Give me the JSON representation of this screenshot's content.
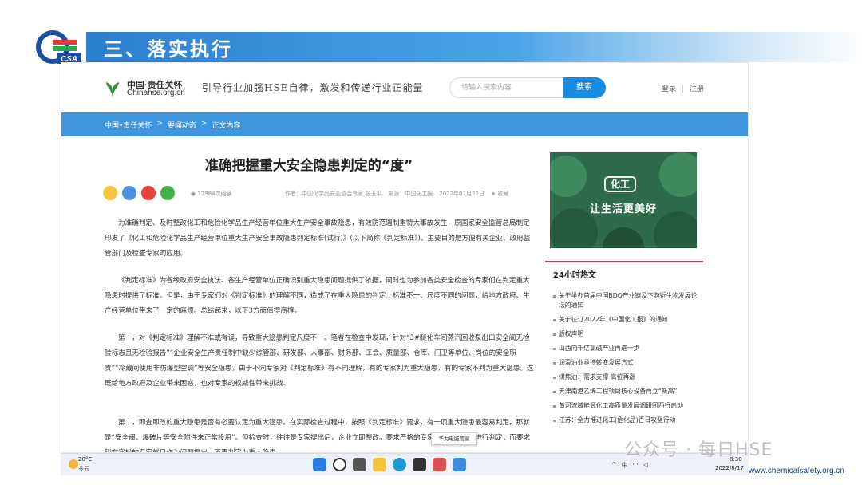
{
  "slide": {
    "title": "三、落实执行",
    "logo_text": "CSA",
    "footer_url": "www.chemicalsafety.org.cn",
    "watermark": "公众号 · 每日HSE"
  },
  "site": {
    "name": "中国·责任关怀",
    "domain": "Chinahse.org.cn",
    "slogan": "引导行业加强HSE自律，激发和传递行业正能量",
    "search_placeholder": "请输入搜索内容",
    "search_button": "搜索",
    "login": "登录",
    "separator": "|",
    "register": "注册"
  },
  "breadcrumb": [
    "中国•责任关怀",
    ">",
    "要闻动态",
    ">",
    "正文内容"
  ],
  "article": {
    "title": "准确把握重大安全隐患判定的“度”",
    "reads": "32984次阅读",
    "author": "作者：中国化学品安全协会专家 张玉平",
    "source": "来源：中国化工报",
    "date": "2022年07月22日",
    "favorite": "收藏",
    "paragraphs": [
      "为准确判定、及时整改化工和危险化学品生产经营单位重大生产安全事故隐患，有效防范遏制重特大事故发生，原国家安全监管总局制定印发了《化工和危险化学品生产经营单位重大生产安全事故隐患判定标准(试行)》(以下简称《判定标准》)，主要目的是方便有关企业、政府监管部门及检查专家的应用。",
      "《判定标准》为各级政府安全执法、各生产经营单位正确识别重大隐患问题提供了依据，同时也为参加各类安全检查的专家们在判定重大隐患时提供了标准。但是，由于专家们对《判定标准》的理解不同，造成了在重大隐患的判定上标准不一、尺度不同的问题，给地方政府、生产经营单位带来了一定的麻烦。总结起来，以下3方面值得商榷。",
      "第一，对《判定标准》理解不准或有误，导致重大隐患判定尺度不一。笔者在检查中发现，针对“3#醚化车间蒸汽回收泵出口安全阀无检验标志且无检验报告”“企业安全生产责任制中缺少综管部、研发部、人事部、财务部、工会、质量部、仓库、门卫等单位、岗位的安全职责”“冷藏间使用非防爆型空调”等安全隐患，由于不同专家对《判定标准》有不同理解，有的专家判为重大隐患，有的专家不判为重大隐患。这既给地方政府及企业带来困惑，也对专家的权威性带来挑战。",
      "第二，即查即改的重大隐患是否有必要认定为重大隐患。在实际检查过程中，按照《判定标准》要求，有一项重大隐患最容易判定，那就是“安全阀、爆破片等安全附件未正常投用”。但检查时，往往是专家提出后，企业立即整改。要求严格的专家们按重大隐患进行判定，而要求稍有宽松的专家就只作为问题提出，不再判定为重大隐患。"
    ]
  },
  "sidebar": {
    "ad_label": "化工",
    "ad_text": "让生活更美好",
    "hot_title": "24小时热文",
    "hot_items": [
      "关于举办首届中国BDO产业链及下游衍生物发展论坛的通知",
      "关于征订2022年《中国化工报》的通知",
      "版权声明",
      "山西向千亿氯碱产业再进一步",
      "润滑油业亟待转变发展方式",
      "煤焦油：需求支撑 高位再涨",
      "天津南港乙烯工程项目核心设备再立“新高”",
      "黄河流域能源化工高质量发展调研团西行启动",
      "江苏：全力推进化工(危化品)百日攻坚行动"
    ]
  },
  "tooltip": "华为电脑管家",
  "taskbar": {
    "temperature": "28°C",
    "weather": "多云",
    "ime": "中",
    "time": "8:30",
    "date": "2022/8/17"
  },
  "colors": {
    "title_bar": "#2d7fd0",
    "nav_bar": "#3f96de",
    "search_button": "#1a8be3",
    "ad_background": "#2e6b4a",
    "hot_accent": "#d23b3b"
  }
}
